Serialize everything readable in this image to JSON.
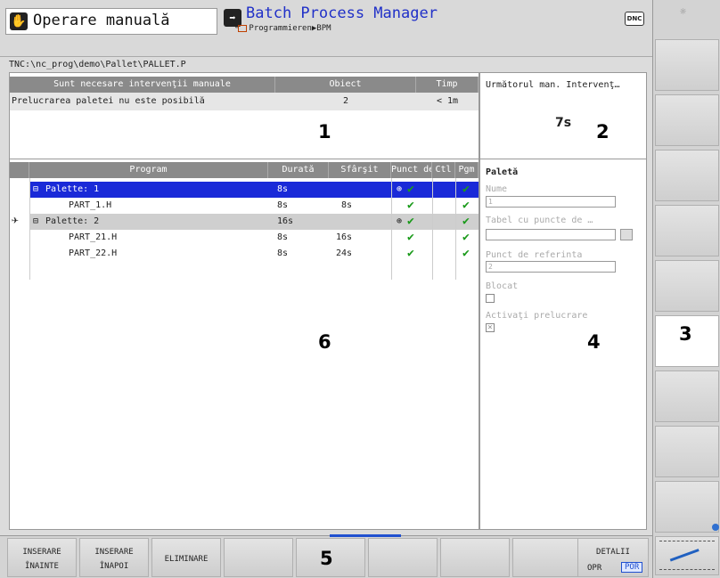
{
  "header": {
    "mode_title": "Operare manuală",
    "app_title": "Batch Process Manager",
    "breadcrumb": "Programmieren▶BPM",
    "dnc_label": "DNC"
  },
  "path": "TNC:\\nc_prog\\demo\\Pallet\\PALLET.P",
  "interventions": {
    "headers": [
      "Sunt necesare intervenţii manuale",
      "Obiect",
      "Timp"
    ],
    "rows": [
      [
        "Prelucrarea paletei nu este posibilă",
        "2",
        "< 1m"
      ]
    ],
    "annotation": "1"
  },
  "next_intervention": {
    "title": "Următorul man. Intervenţ…",
    "value": "7s",
    "annotation": "2"
  },
  "program_table": {
    "headers": [
      "Program",
      "Durată",
      "Sfârşit",
      "Punct de ref.",
      "Ctl",
      "Pgm"
    ],
    "rows": [
      {
        "name": "Palette: 1",
        "duration": "8s",
        "end": "",
        "selected": true
      },
      {
        "name": "PART_1.H",
        "duration": "8s",
        "end": "8s",
        "selected": false
      },
      {
        "name": "Palette: 2",
        "duration": "16s",
        "end": "",
        "selected": false
      },
      {
        "name": "PART_21.H",
        "duration": "8s",
        "end": "16s",
        "selected": false
      },
      {
        "name": "PART_22.H",
        "duration": "8s",
        "end": "24s",
        "selected": false
      }
    ],
    "annotation": "6"
  },
  "pallet_panel": {
    "title": "Paletă",
    "name_label": "Nume",
    "name_value": "1",
    "ref_table_label": "Tabel cu puncte de …",
    "ref_table_value": "",
    "ref_point_label": "Punct de referinta",
    "ref_point_value": "2",
    "locked_label": "Blocat",
    "activate_label": "Activaţi prelucrare",
    "annotation": "4"
  },
  "sidebar_annotation": "3",
  "softkeys": {
    "insert_before_1": "INSERARE",
    "insert_before_2": "ÎNAINTE",
    "insert_after_1": "INSERARE",
    "insert_after_2": "ÎNAPOI",
    "delete": "ELIMINARE",
    "details": "DETALII",
    "opr": "OPR",
    "por": "POR",
    "annotation": "5"
  }
}
